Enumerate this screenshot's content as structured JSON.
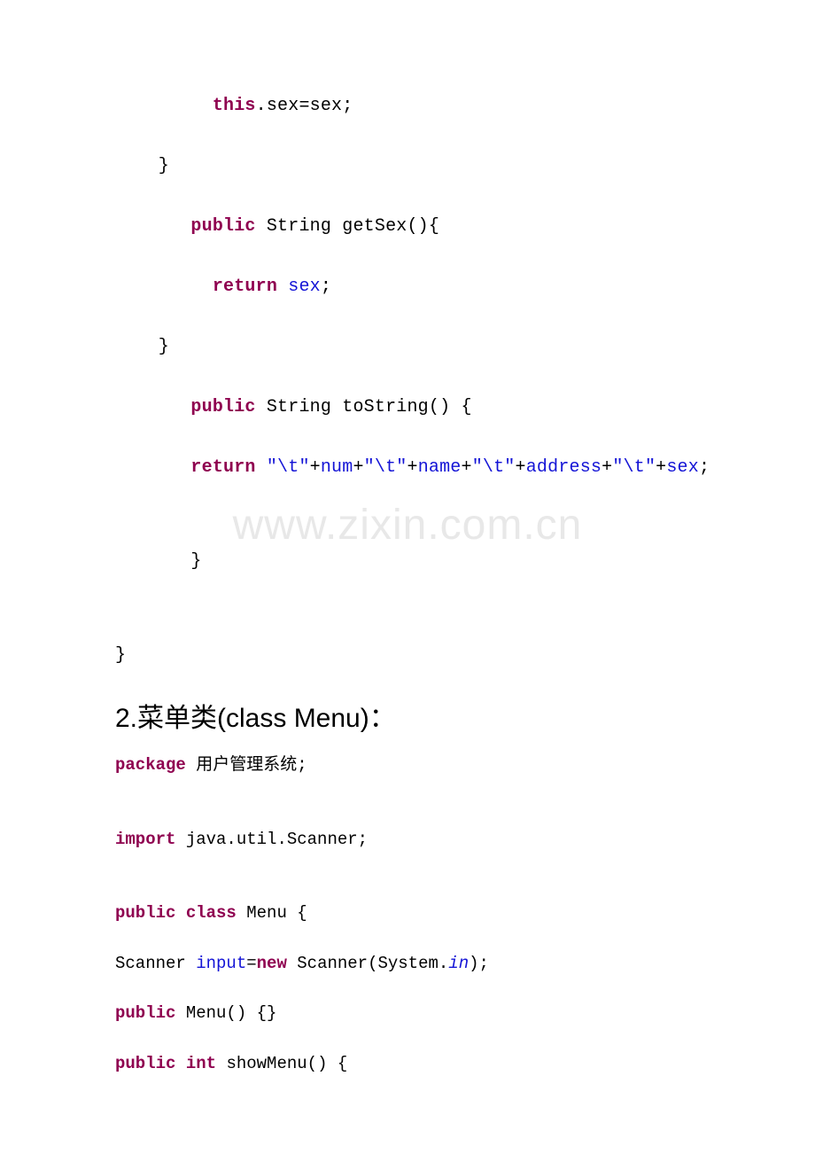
{
  "watermark": "www.zixin.com.cn",
  "codeTop": {
    "l1": {
      "kw": "this",
      "rest": ".sex=sex;"
    },
    "l2": "    }",
    "l3": {
      "pre": "       ",
      "kw": "public",
      "rest": " String getSex(){"
    },
    "l4": {
      "pre": "         ",
      "kw": "return",
      "mid": " ",
      "fld": "sex",
      "post": ";"
    },
    "l5": "    }",
    "l6": {
      "pre": "       ",
      "kw": "public",
      "rest": " String toString() {"
    },
    "l7": {
      "pre": "       ",
      "kw": "return",
      "mid": " ",
      "s1": "\"\\t\"",
      "plus": "+",
      "f1": "num",
      "s2": "\"\\t\"",
      "f2": "name",
      "s3": "\"\\t\"",
      "f3": "address",
      "s4": "\"\\t\"",
      "f4": "sex",
      "end": ";"
    },
    "l8": "       }",
    "l9": "}"
  },
  "heading": "2.菜单类(class Menu)：",
  "codeBottom": {
    "l1": {
      "kw": "package",
      "rest": " 用户管理系统;"
    },
    "l2": {
      "kw": "import",
      "rest": " java.util.Scanner;"
    },
    "l3": {
      "kw1": "public",
      "kw2": "class",
      "rest": " Menu {"
    },
    "l4": {
      "pre": "Scanner ",
      "fld": "input",
      "eq": "=",
      "kw": "new",
      "mid": " Scanner(System.",
      "in": "in",
      "post": ");"
    },
    "l5": {
      "kw": "public",
      "rest": " Menu() {}"
    },
    "l6": {
      "kw1": "public",
      "kw2": "int",
      "rest": " showMenu() {"
    }
  }
}
